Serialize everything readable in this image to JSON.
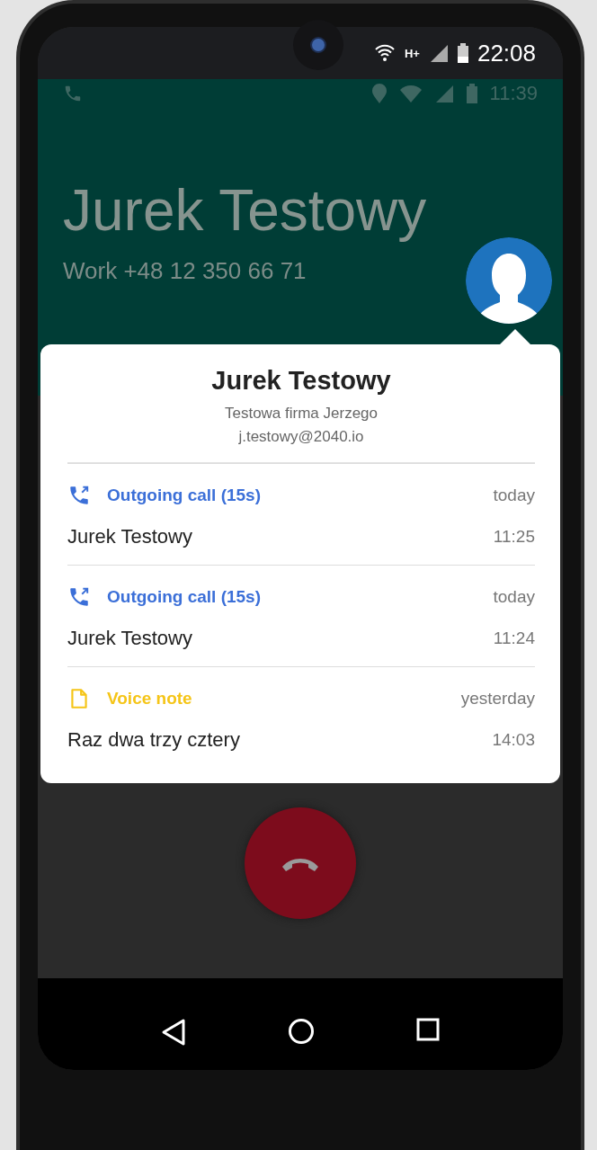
{
  "status_bar": {
    "network": "H+",
    "time": "22:08"
  },
  "inner_status_bar": {
    "time": "11:39"
  },
  "call": {
    "name": "Jurek Testowy",
    "number": "Work +48 12 350 66 71"
  },
  "contact_card": {
    "name": "Jurek Testowy",
    "company": "Testowa firma Jerzego",
    "email": "j.testowy@2040.io",
    "entries": [
      {
        "kind": "call",
        "title": "Outgoing call (15s)",
        "subtitle": "Jurek Testowy",
        "day": "today",
        "time": "11:25"
      },
      {
        "kind": "call",
        "title": "Outgoing call (15s)",
        "subtitle": "Jurek Testowy",
        "day": "today",
        "time": "11:24"
      },
      {
        "kind": "note",
        "title": "Voice note",
        "subtitle": "Raz dwa trzy cztery",
        "day": "yesterday",
        "time": "14:03"
      }
    ]
  }
}
